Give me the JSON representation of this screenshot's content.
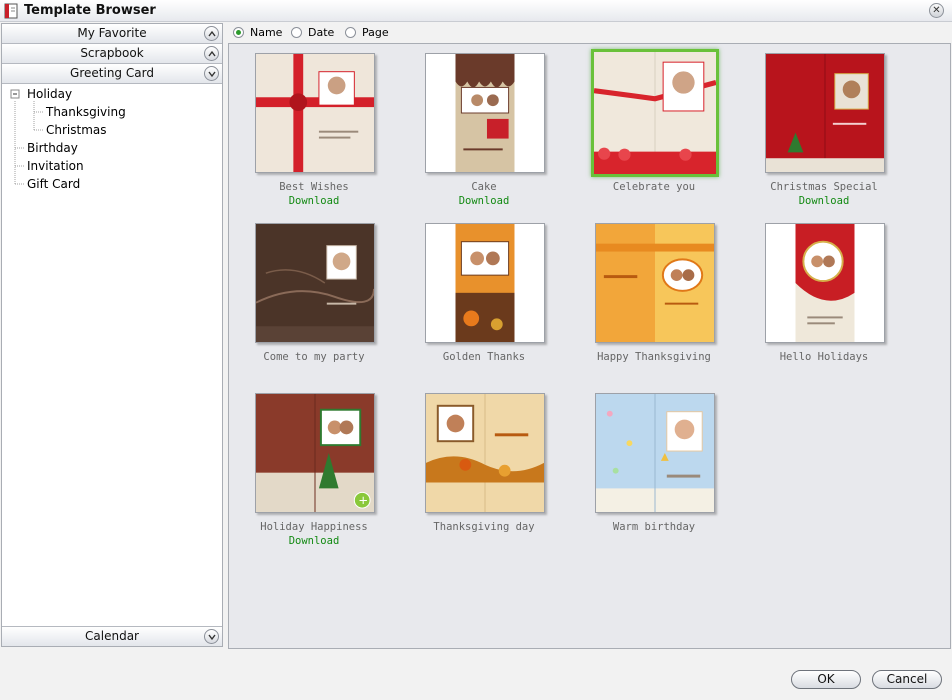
{
  "window": {
    "title": "Template Browser"
  },
  "sidebar": {
    "sections": [
      {
        "label": "My Favorite"
      },
      {
        "label": "Scrapbook"
      },
      {
        "label": "Greeting Card"
      }
    ],
    "tree": [
      {
        "label": "Holiday",
        "level": 0,
        "expander": "−"
      },
      {
        "label": "Thanksgiving",
        "level": 1
      },
      {
        "label": "Christmas",
        "level": 1
      },
      {
        "label": "Birthday",
        "level": 0
      },
      {
        "label": "Invitation",
        "level": 0
      },
      {
        "label": "Gift Card",
        "level": 0
      }
    ],
    "bottom_section": {
      "label": "Calendar"
    }
  },
  "sort": {
    "options": [
      {
        "label": "Name",
        "checked": true
      },
      {
        "label": "Date",
        "checked": false
      },
      {
        "label": "Page",
        "checked": false
      }
    ]
  },
  "templates": [
    {
      "title": "Best Wishes",
      "download": "Download",
      "palette": [
        "#efe6da",
        "#d4202a"
      ]
    },
    {
      "title": "Cake",
      "download": "Download",
      "palette": [
        "#6a3a2a",
        "#d6c4a4"
      ]
    },
    {
      "title": "Celebrate you",
      "download": "",
      "selected": true,
      "palette": [
        "#f0e8dc",
        "#d8242c"
      ]
    },
    {
      "title": "Christmas Special",
      "download": "Download",
      "palette": [
        "#b8141c",
        "#e9e2d6"
      ]
    },
    {
      "title": "Come to my party",
      "download": "",
      "palette": [
        "#4b3428",
        "#8a6a58"
      ]
    },
    {
      "title": "Golden Thanks",
      "download": "",
      "palette": [
        "#e8912c",
        "#6b3a1c"
      ]
    },
    {
      "title": "Happy Thanksgiving",
      "download": "",
      "palette": [
        "#f2a63a",
        "#f7c65a"
      ]
    },
    {
      "title": "Hello Holidays",
      "download": "",
      "palette": [
        "#c81e24",
        "#efe8da"
      ]
    },
    {
      "title": "Holiday Happiness",
      "download": "Download",
      "palette": [
        "#8a3a2a",
        "#e3d9c8"
      ]
    },
    {
      "title": "Thanksgiving day",
      "download": "",
      "palette": [
        "#f0d8a8",
        "#c8781c"
      ]
    },
    {
      "title": "Warm birthday",
      "download": "",
      "palette": [
        "#bcd8ee",
        "#f4f0e4"
      ]
    }
  ],
  "buttons": {
    "ok": "OK",
    "cancel": "Cancel"
  },
  "colors": {
    "accent": "#6ac13a",
    "download": "#138a13"
  }
}
